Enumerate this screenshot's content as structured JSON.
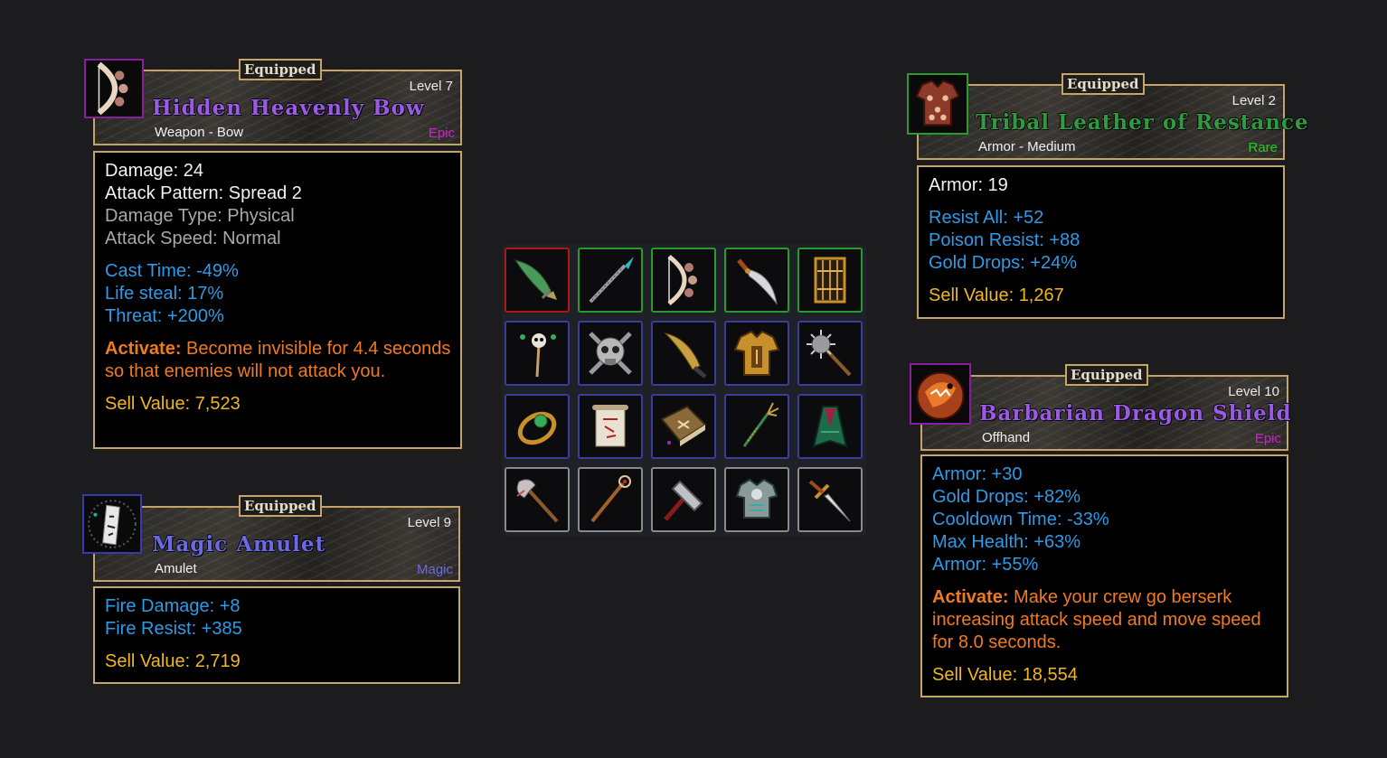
{
  "colors": {
    "frame": "#c5a46a",
    "epic": "#9b5ae6",
    "epic_label": "#d21ed2",
    "rare_name": "#2f9a3e",
    "rare_label": "#22cc22",
    "magic": "#6a6ae6",
    "stat_blue": "#2f9ae6",
    "activate_orange": "#f07a1e",
    "sell_gold": "#f0b81e"
  },
  "cards": {
    "bow": {
      "equipped": "Equipped",
      "level": "Level 7",
      "name": "Hidden Heavenly Bow",
      "subtype": "Weapon - Bow",
      "rarity": "Epic",
      "icon": "bow-icon",
      "stats": {
        "damage": "Damage: 24",
        "attack_pattern": "Attack Pattern: Spread 2",
        "damage_type": "Damage Type: Physical",
        "attack_speed": "Attack Speed: Normal"
      },
      "bonuses": [
        "Cast Time: -49%",
        "Life steal: 17%",
        "Threat: +200%"
      ],
      "activate_label": "Activate:",
      "activate_text": "Become invisible for 4.4 seconds so that enemies will not attack you.",
      "sell_value": "Sell Value: 7,523"
    },
    "amulet": {
      "equipped": "Equipped",
      "level": "Level 9",
      "name": "Magic Amulet",
      "subtype": "Amulet",
      "rarity": "Magic",
      "icon": "amulet-icon",
      "bonuses": [
        "Fire Damage: +8",
        "Fire Resist: +385"
      ],
      "sell_value": "Sell Value: 2,719"
    },
    "leather": {
      "equipped": "Equipped",
      "level": "Level 2",
      "name": "Tribal Leather of Restance",
      "subtype": "Armor - Medium",
      "rarity": "Rare",
      "icon": "leather-armor-icon",
      "stats": {
        "armor": "Armor: 19"
      },
      "bonuses": [
        "Resist All: +52",
        "Poison Resist: +88",
        "Gold Drops: +24%"
      ],
      "sell_value": "Sell Value: 1,267"
    },
    "shield": {
      "equipped": "Equipped",
      "level": "Level 10",
      "name": "Barbarian Dragon Shield",
      "subtype": "Offhand",
      "rarity": "Epic",
      "icon": "dragon-shield-icon",
      "bonuses": [
        "Armor: +30",
        "Gold Drops: +82%",
        "Cooldown Time: -33%",
        "Max Health: +63%",
        "Armor: +55%"
      ],
      "activate_label": "Activate:",
      "activate_text": "Make your crew go berserk increasing attack speed and move speed for 8.0 seconds.",
      "sell_value": "Sell Value: 18,554"
    }
  },
  "inventory": {
    "slots": [
      {
        "icon": "green-sword-icon",
        "border": "#b01818"
      },
      {
        "icon": "spear-icon",
        "border": "#2a9a2a"
      },
      {
        "icon": "bow-icon",
        "border": "#2a9a2a"
      },
      {
        "icon": "curved-dagger-icon",
        "border": "#2a9a2a"
      },
      {
        "icon": "gate-shield-icon",
        "border": "#2a9a2a"
      },
      {
        "icon": "skull-staff-icon",
        "border": "#3c3c9a"
      },
      {
        "icon": "skull-crossbones-icon",
        "border": "#3c3c9a"
      },
      {
        "icon": "machete-icon",
        "border": "#3c3c9a"
      },
      {
        "icon": "gold-armor-icon",
        "border": "#3c3c9a"
      },
      {
        "icon": "morning-star-icon",
        "border": "#3c3c9a"
      },
      {
        "icon": "ring-icon",
        "border": "#3c3c9a"
      },
      {
        "icon": "scroll-icon",
        "border": "#3c3c9a"
      },
      {
        "icon": "spellbook-icon",
        "border": "#3c3c9a"
      },
      {
        "icon": "trident-icon",
        "border": "#3c3c9a"
      },
      {
        "icon": "green-cloak-icon",
        "border": "#3c3c9a"
      },
      {
        "icon": "axe-icon",
        "border": "#8a8a8a"
      },
      {
        "icon": "staff-icon",
        "border": "#8a8a8a"
      },
      {
        "icon": "hammer-icon",
        "border": "#8a8a8a"
      },
      {
        "icon": "chest-armor-icon",
        "border": "#8a8a8a"
      },
      {
        "icon": "short-sword-icon",
        "border": "#8a8a8a"
      }
    ]
  }
}
